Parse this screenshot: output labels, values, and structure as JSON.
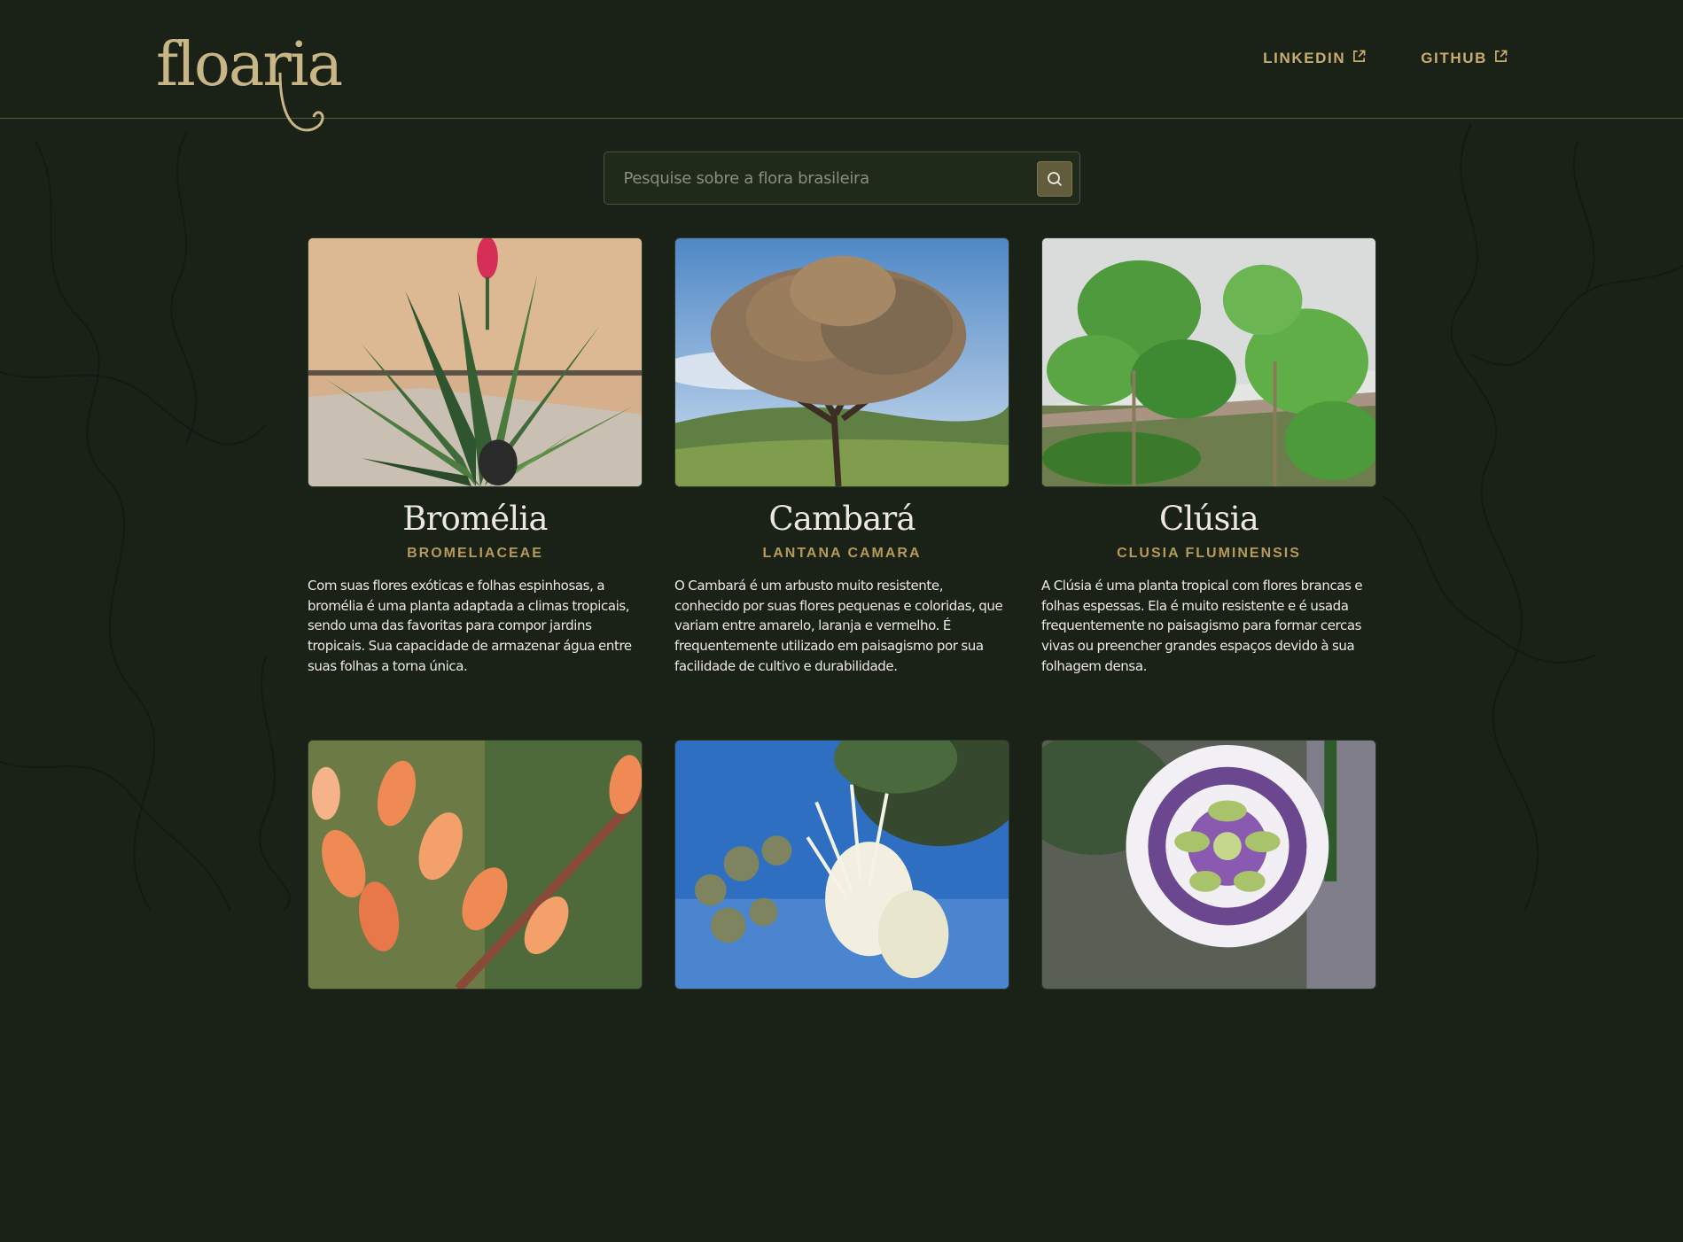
{
  "brand": {
    "logo_text": "floaria"
  },
  "nav": {
    "links": [
      {
        "label": "LINKEDIN",
        "icon": "external-link-icon"
      },
      {
        "label": "GITHUB",
        "icon": "external-link-icon"
      }
    ]
  },
  "search": {
    "placeholder": "Pesquise sobre a flora brasileira",
    "value": "",
    "button_icon": "search-icon"
  },
  "colors": {
    "background": "#1a2117",
    "accent_gold": "#c8ad6c",
    "subtitle_gold": "#b59a5b",
    "search_button": "#615d3c"
  },
  "cards": [
    {
      "title": "Bromélia",
      "subtitle": "BROMELIACEAE",
      "description": "Com suas flores exóticas e folhas espinhosas, a bromélia é uma planta adaptada a climas tropicais, sendo uma das favoritas para compor jardins tropicais. Sua capacidade de armazenar água entre suas folhas a torna única."
    },
    {
      "title": "Cambará",
      "subtitle": "LANTANA CAMARA",
      "description": "O Cambará é um arbusto muito resistente, conhecido por suas flores pequenas e coloridas, que variam entre amarelo, laranja e vermelho. É frequentemente utilizado em paisagismo por sua facilidade de cultivo e durabilidade."
    },
    {
      "title": "Clúsia",
      "subtitle": "CLUSIA FLUMINENSIS",
      "description": "A Clúsia é uma planta tropical com flores brancas e folhas espessas. Ela é muito resistente e é usada frequentemente no paisagismo para formar cercas vivas ou preencher grandes espaços devido à sua folhagem densa."
    },
    {
      "title": "",
      "subtitle": "",
      "description": ""
    },
    {
      "title": "",
      "subtitle": "",
      "description": ""
    },
    {
      "title": "",
      "subtitle": "",
      "description": ""
    }
  ]
}
